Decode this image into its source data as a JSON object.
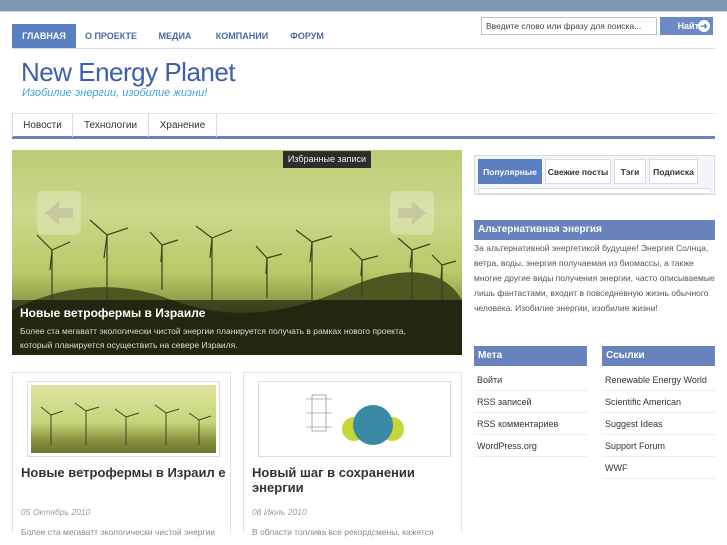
{
  "topnav": {
    "items": [
      "ГЛАВНАЯ",
      "О ПРОЕКТЕ",
      "МЕДИА",
      "КОМПАНИИ",
      "ФОРУМ"
    ],
    "active": "ГЛАВНАЯ"
  },
  "search": {
    "value": "Введите слово или фразу для поиска...",
    "button_label": "Найти"
  },
  "logo": {
    "title": "New Energy Planet",
    "subtitle": "Изобилие энергии, изобилие жизни!"
  },
  "catnav": {
    "items": [
      "Новости",
      "Технологии",
      "Хранение"
    ]
  },
  "featured": {
    "label": "Избранные записи",
    "title": "Новые ветрофермы в Израиле",
    "text_line1": "Более ста мегаватт экологически чистой энергии планируется получать в рамках нового проекта,",
    "text_line2": "который планируется осуществить на севере Израиля."
  },
  "posts": [
    {
      "title": "Новые ветрофермы в Израил е",
      "date": "05 Октябрь 2010",
      "excerpt": "Более ста мегаватт экологически чистой энергии"
    },
    {
      "title": "Новый шаг в сохранении энергии",
      "date": "08 Июль 2010",
      "excerpt": "В области топлива все рекордсмены, кажется"
    }
  ],
  "sidebar": {
    "tabs": [
      "Популярные",
      "Свежие посты",
      "Тэги",
      "Подписка"
    ],
    "active_tab": "Популярные",
    "about_title": "Альтернативная энергия",
    "about_text": "За альтернативной энергетикой будущее! Энергия Солнца, ветра, воды, энергия получаемая из биомассы, а также многие другие виды получения энергии, часто описываемые лишь фантастами, входит в повседневную жизнь обычного человека. Изобилие энергии, изобилие жизни!",
    "meta_title": "Мета",
    "meta_items": [
      "Войти",
      "RSS записей",
      "RSS комментариев",
      "WordPress.org"
    ],
    "links_title": "Ссылки",
    "links_items": [
      "Renewable Energy World",
      "Scientific American",
      "Suggest Ideas",
      "Support Forum",
      "WWF"
    ]
  },
  "colors": {
    "accent": "#6882bb",
    "logo": "#3c5eab",
    "tagline": "#3fa0d8"
  }
}
